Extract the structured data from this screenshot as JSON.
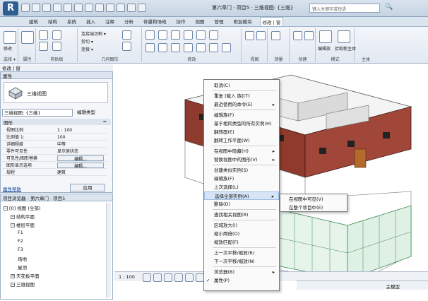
{
  "titlebar": {
    "title": "第六章门 · 项目5 · 三维视图: {三维}",
    "search_placeholder": "键入关键字或短语",
    "binoc": "🔍"
  },
  "ribbon_tabs": [
    "建筑",
    "结构",
    "系统",
    "插入",
    "注释",
    "分析",
    "体量和场地",
    "协作",
    "视图",
    "管理",
    "附加模块",
    "修改 | 窗"
  ],
  "ribbon_groups": [
    {
      "label": "选择 ▾",
      "items": [
        "修改"
      ]
    },
    {
      "label": "属性",
      "items": []
    },
    {
      "label": "剪贴板",
      "items": [
        "连接端切割 ▾",
        "剪切 ▾",
        "连接 ▾"
      ]
    },
    {
      "label": "几何图形",
      "items": []
    },
    {
      "label": "修改",
      "items": []
    },
    {
      "label": "视图",
      "items": []
    },
    {
      "label": "测量",
      "items": []
    },
    {
      "label": "创建",
      "items": []
    },
    {
      "label": "模式",
      "items": [
        "编辑族",
        "拾取新主体"
      ]
    },
    {
      "label": "主体",
      "items": []
    }
  ],
  "breadcrumb": "修改 | 窗",
  "properties": {
    "header": "属性",
    "type_name": "三维视图",
    "view_select": "三维视图: {三维}",
    "edit_type": "编辑类型",
    "section": "图形",
    "section_toggle": "≈",
    "rows": [
      {
        "name": "视图比例",
        "value": "1 : 100"
      },
      {
        "name": "比例值 1:",
        "value": "100"
      },
      {
        "name": "详细程度",
        "value": "中等"
      },
      {
        "name": "零件可见性",
        "value": "显示原状态"
      },
      {
        "name": "可见性/图形替换",
        "value": "编辑..."
      },
      {
        "name": "图形显示选项",
        "value": "编辑..."
      },
      {
        "name": "规程",
        "value": "建筑"
      }
    ],
    "help_link": "属性帮助",
    "apply": "应用"
  },
  "browser": {
    "header": "项目浏览器 - 第六章门 · 项目5",
    "nodes": [
      {
        "indent": 0,
        "toggle": "−",
        "label": "[0] 视图 (全部)"
      },
      {
        "indent": 1,
        "toggle": "−",
        "label": "结构平面"
      },
      {
        "indent": 1,
        "toggle": "−",
        "label": "楼层平面"
      },
      {
        "indent": 2,
        "toggle": "",
        "label": "F1"
      },
      {
        "indent": 2,
        "toggle": "",
        "label": "F2"
      },
      {
        "indent": 2,
        "toggle": "",
        "label": "F3"
      },
      {
        "indent": 2,
        "toggle": "",
        "label": "场地"
      },
      {
        "indent": 2,
        "toggle": "",
        "label": "屋顶"
      },
      {
        "indent": 1,
        "toggle": "+",
        "label": "天花板平面"
      },
      {
        "indent": 1,
        "toggle": "−",
        "label": "三维视图"
      }
    ]
  },
  "statusbar": {
    "scale": "1 : 100",
    "right": "主模型"
  },
  "context_menu": {
    "items": [
      {
        "label": "取消(C)",
        "sep_after": true
      },
      {
        "label": "重复 [载入 族](T)"
      },
      {
        "label": "最近使用的命令(E)",
        "arrow": "▸",
        "sep_after": true
      },
      {
        "label": "编辑族(F)"
      },
      {
        "label": "基于相同类型的所有实例(H)"
      },
      {
        "label": "翻转面(E)"
      },
      {
        "label": "翻转工作平面(W)",
        "sep_after": true
      },
      {
        "label": "在视图中隐藏(H)",
        "arrow": "▸"
      },
      {
        "label": "替换视图中的图形(V)",
        "arrow": "▸",
        "sep_after": true
      },
      {
        "label": "创建类似实例(S)"
      },
      {
        "label": "编辑族(F)"
      },
      {
        "label": "上次选择(L)"
      },
      {
        "label": "选择全部实例(A)",
        "arrow": "▸",
        "highlighted": true
      },
      {
        "label": "删除(D)",
        "sep_after": true
      },
      {
        "label": "查找相关视图(R)",
        "sep_after": true
      },
      {
        "label": "区域放大(I)"
      },
      {
        "label": "缩小两倍(O)"
      },
      {
        "label": "缩放匹配(F)",
        "sep_after": true
      },
      {
        "label": "上一次平移/缩放(R)"
      },
      {
        "label": "下一次平移/缩放(N)",
        "sep_after": true
      },
      {
        "label": "浏览器(B)",
        "arrow": "▸"
      },
      {
        "label": "属性(P)",
        "checked": "✓"
      }
    ],
    "submenu": [
      "在视图中可见(V)",
      "在整个项目中(E)"
    ]
  }
}
